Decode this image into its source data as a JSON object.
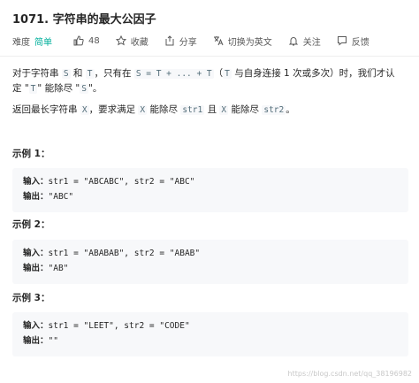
{
  "problem": {
    "title": "1071. 字符串的最大公因子",
    "difficulty_label": "难度",
    "difficulty_value": "简单"
  },
  "toolbar": {
    "like_count": "48",
    "favorite_label": "收藏",
    "share_label": "分享",
    "translate_label": "切换为英文",
    "follow_label": "关注",
    "feedback_label": "反馈"
  },
  "description": {
    "p1_a": "对于字符串 ",
    "p1_s": "S",
    "p1_b": " 和 ",
    "p1_t": "T",
    "p1_c": "，只有在 ",
    "p1_formula": "S = T + ... + T",
    "p1_d": "（",
    "p1_t2": "T",
    "p1_e": " 与自身连接 1 次或多次）时，我们才认定 \"",
    "p1_t3": "T",
    "p1_f": "\" 能除尽 \"",
    "p1_s2": "S",
    "p1_g": "\"。",
    "p2_a": "返回最长字符串 ",
    "p2_x": "X",
    "p2_b": "，要求满足 ",
    "p2_x2": "X",
    "p2_c": " 能除尽 ",
    "p2_str1": "str1",
    "p2_d": " 且 ",
    "p2_x3": "X",
    "p2_e": " 能除尽 ",
    "p2_str2": "str2",
    "p2_f": "。"
  },
  "examples": [
    {
      "title": "示例 1：",
      "input_label": "输入：",
      "input": "str1 = \"ABCABC\", str2 = \"ABC\"",
      "output_label": "输出：",
      "output": "\"ABC\""
    },
    {
      "title": "示例 2：",
      "input_label": "输入：",
      "input": "str1 = \"ABABAB\", str2 = \"ABAB\"",
      "output_label": "输出：",
      "output": "\"AB\""
    },
    {
      "title": "示例 3：",
      "input_label": "输入：",
      "input": "str1 = \"LEET\", str2 = \"CODE\"",
      "output_label": "输出：",
      "output": "\"\""
    }
  ],
  "watermark": "https://blog.csdn.net/qq_38196982",
  "icons": {
    "like": "thumbs-up-icon",
    "favorite": "star-icon",
    "share": "share-icon",
    "translate": "translate-icon",
    "follow": "bell-icon",
    "feedback": "feedback-icon"
  },
  "colors": {
    "difficulty_easy": "#00af9b",
    "code_bg": "#f7f8fa",
    "inline_code": "#546e7a"
  }
}
